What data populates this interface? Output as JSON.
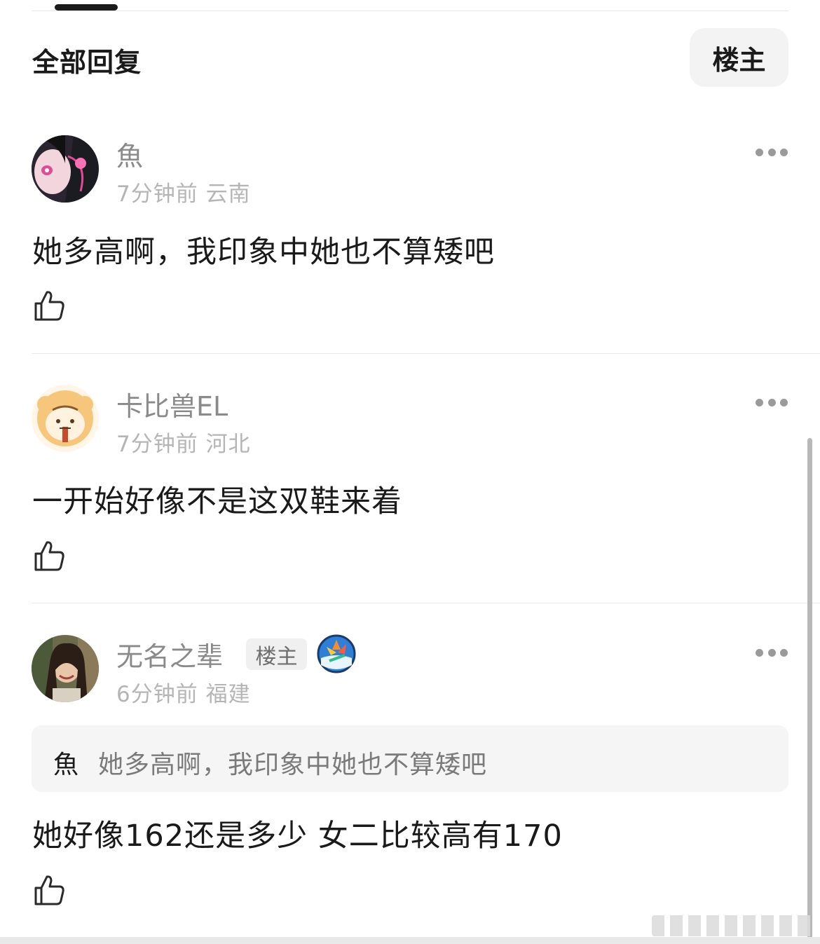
{
  "header": {
    "title": "全部回复",
    "filter_button": "楼主"
  },
  "comments": [
    {
      "username": "魚",
      "meta": "7分钟前 云南",
      "text": "她多高啊，我印象中她也不算矮吧"
    },
    {
      "username": "卡比兽EL",
      "meta": "7分钟前 河北",
      "text": "一开始好像不是这双鞋来着"
    },
    {
      "username": "无名之辈",
      "badge": "楼主",
      "meta": "6分钟前 福建",
      "quote": {
        "author": "魚",
        "text": "她多高啊，我印象中她也不算矮吧"
      },
      "text": "她好像162还是多少 女二比较高有170"
    }
  ],
  "icons": {
    "more": "more-horizontal-icon",
    "like": "thumbs-up-icon",
    "vip": "vip-badge-icon"
  },
  "colors": {
    "text_primary": "#1a1a1a",
    "text_secondary": "#8a8a8a",
    "text_muted": "#b5b5b5",
    "button_bg": "#f3f3f3"
  }
}
